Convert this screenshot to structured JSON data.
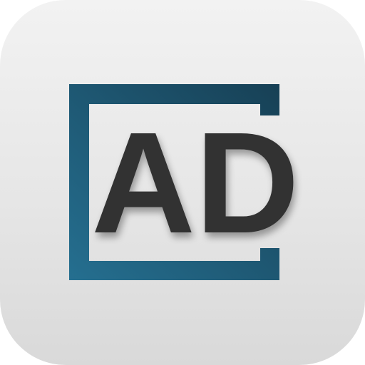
{
  "app_icon": {
    "monogram": "AD",
    "colors": {
      "background_top": "#f2f2f2",
      "background_bottom": "#d9d9d9",
      "frame_light": "#256f90",
      "frame_dark": "#174055",
      "monogram": "#333333"
    }
  }
}
